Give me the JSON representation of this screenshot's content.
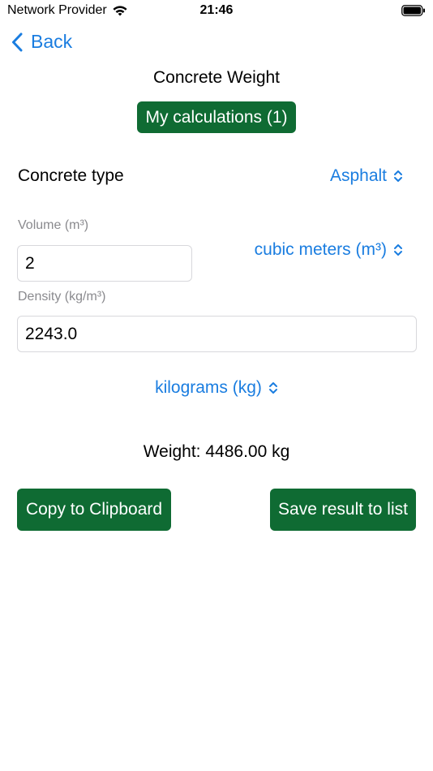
{
  "status_bar": {
    "carrier": "Network Provider",
    "time": "21:46"
  },
  "nav": {
    "back_label": "Back"
  },
  "page": {
    "title": "Concrete Weight",
    "my_calculations_label": "My calculations (1)"
  },
  "concrete_type": {
    "label": "Concrete type",
    "selected": "Asphalt"
  },
  "volume": {
    "label": "Volume (m³)",
    "value": "2",
    "unit_selected": "cubic meters (m³)"
  },
  "density": {
    "label": "Density (kg/m³)",
    "value": "2243.0"
  },
  "weight_unit": {
    "selected": "kilograms (kg)"
  },
  "result": {
    "text": "Weight: 4486.00 kg"
  },
  "actions": {
    "copy_label": "Copy to Clipboard",
    "save_label": "Save result to list"
  },
  "colors": {
    "accent_blue": "#1a7de0",
    "button_green": "#0f6b33"
  }
}
